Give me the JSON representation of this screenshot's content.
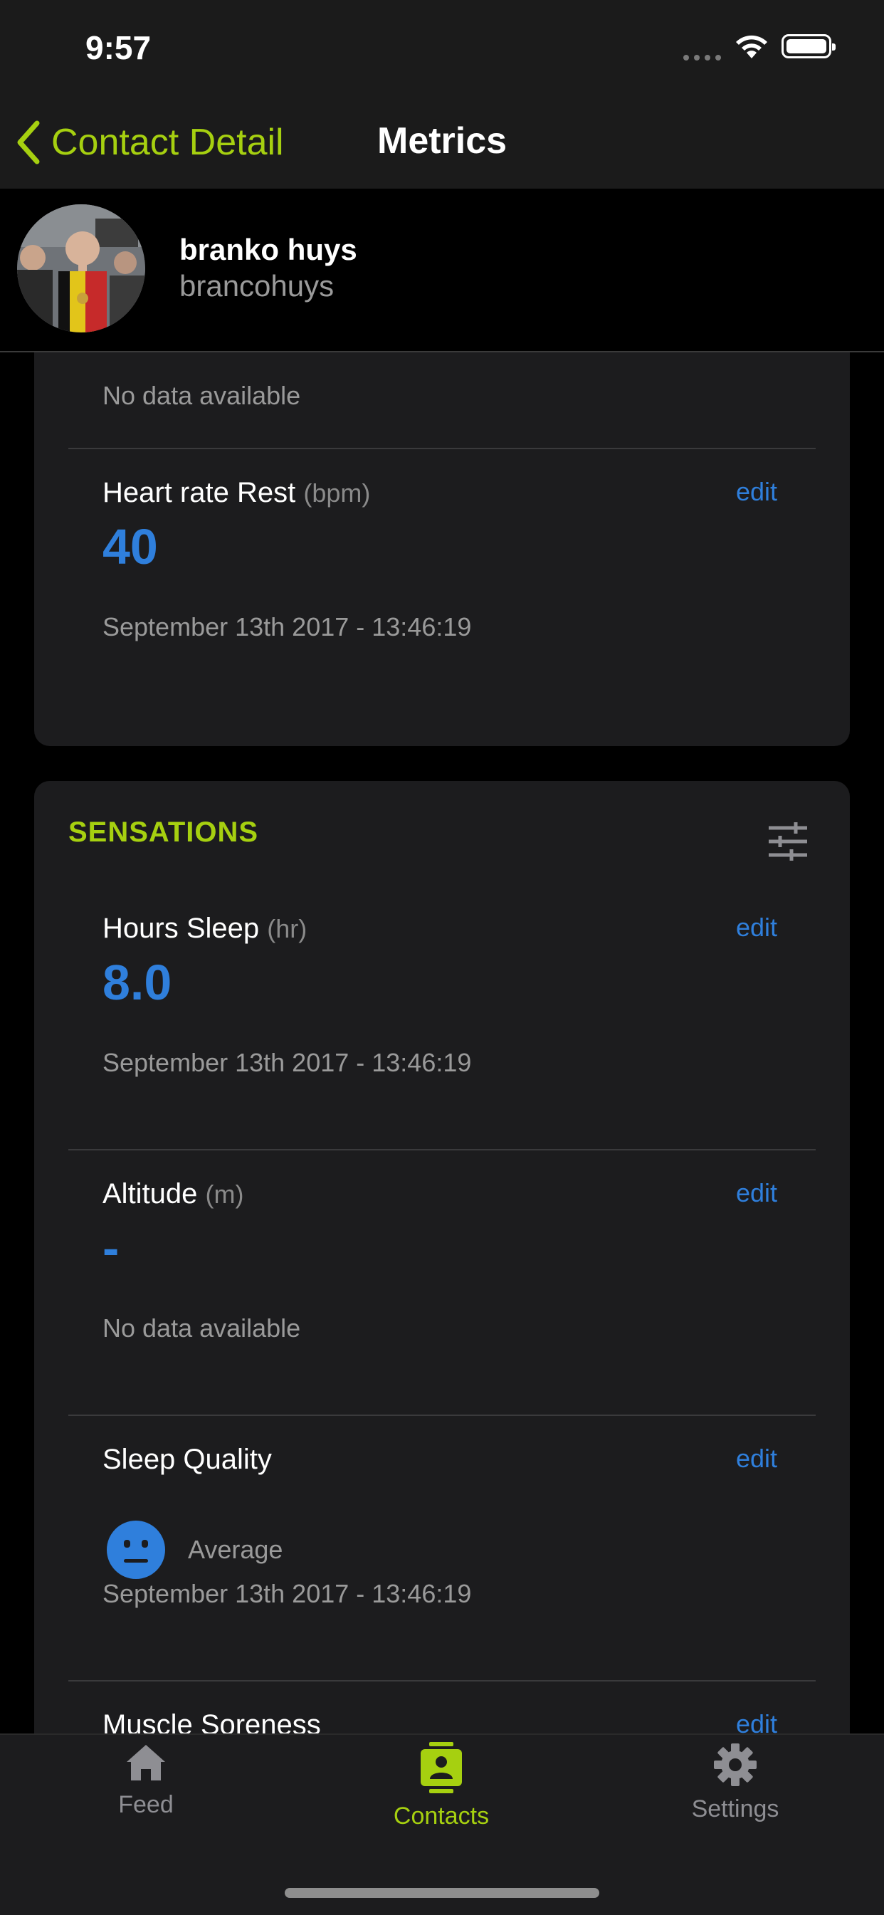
{
  "status_bar": {
    "time": "9:57"
  },
  "nav": {
    "back_label": "Contact Detail",
    "title": "Metrics"
  },
  "profile": {
    "name": "branko huys",
    "username": "brancohuys"
  },
  "metrics_top": {
    "partial_note": "No data available",
    "heart_rate": {
      "label": "Heart rate Rest",
      "unit": "(bpm)",
      "edit": "edit",
      "value": "40",
      "date": "September 13th 2017 - 13:46:19"
    }
  },
  "sensations": {
    "title": "SENSATIONS",
    "hours_sleep": {
      "label": "Hours Sleep",
      "unit": "(hr)",
      "edit": "edit",
      "value": "8.0",
      "date": "September 13th 2017 - 13:46:19"
    },
    "altitude": {
      "label": "Altitude",
      "unit": "(m)",
      "edit": "edit",
      "value": "-",
      "note": "No data available"
    },
    "sleep_quality": {
      "label": "Sleep Quality",
      "edit": "edit",
      "rating": "Average",
      "date": "September 13th 2017 - 13:46:19"
    },
    "muscle_soreness": {
      "label": "Muscle Soreness",
      "edit": "edit"
    }
  },
  "tabbar": {
    "tabs": [
      {
        "label": "Feed",
        "icon": "home-icon",
        "active": false
      },
      {
        "label": "Contacts",
        "icon": "contact-card-icon",
        "active": true
      },
      {
        "label": "Settings",
        "icon": "gear-icon",
        "active": false
      }
    ]
  },
  "colors": {
    "accent": "#a6d010",
    "value_blue": "#2f7fdc",
    "card_bg": "#1c1c1e"
  }
}
